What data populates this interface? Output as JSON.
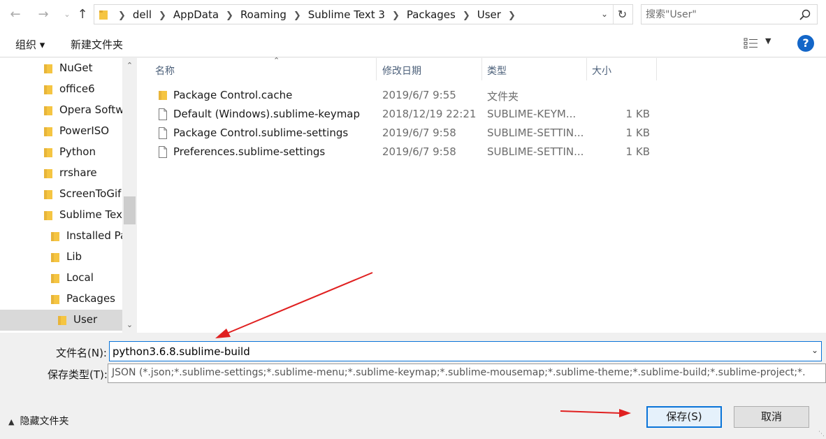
{
  "address": {
    "crumbs": [
      "dell",
      "AppData",
      "Roaming",
      "Sublime Text 3",
      "Packages",
      "User"
    ]
  },
  "search": {
    "placeholder": "搜索\"User\""
  },
  "toolbar": {
    "organize": "组织 ▾",
    "new_folder": "新建文件夹",
    "help": "?"
  },
  "tree": {
    "items": [
      {
        "label": "NuGet",
        "indent": 0,
        "selected": false
      },
      {
        "label": "office6",
        "indent": 0,
        "selected": false
      },
      {
        "label": "Opera Softw",
        "indent": 0,
        "selected": false
      },
      {
        "label": "PowerISO",
        "indent": 0,
        "selected": false
      },
      {
        "label": "Python",
        "indent": 0,
        "selected": false
      },
      {
        "label": "rrshare",
        "indent": 0,
        "selected": false
      },
      {
        "label": "ScreenToGif",
        "indent": 0,
        "selected": false
      },
      {
        "label": "Sublime Tex",
        "indent": 0,
        "selected": false
      },
      {
        "label": "Installed Pa",
        "indent": 1,
        "selected": false
      },
      {
        "label": "Lib",
        "indent": 1,
        "selected": false
      },
      {
        "label": "Local",
        "indent": 1,
        "selected": false
      },
      {
        "label": "Packages",
        "indent": 1,
        "selected": false
      },
      {
        "label": "User",
        "indent": 2,
        "selected": true
      }
    ]
  },
  "columns": {
    "name": "名称",
    "date": "修改日期",
    "type": "类型",
    "size": "大小"
  },
  "files": [
    {
      "name": "Package Control.cache",
      "date": "2019/6/7 9:55",
      "type": "文件夹",
      "size": "",
      "kind": "folder"
    },
    {
      "name": "Default (Windows).sublime-keymap",
      "date": "2018/12/19 22:21",
      "type": "SUBLIME-KEYM...",
      "size": "1 KB",
      "kind": "file"
    },
    {
      "name": "Package Control.sublime-settings",
      "date": "2019/6/7 9:58",
      "type": "SUBLIME-SETTIN...",
      "size": "1 KB",
      "kind": "file"
    },
    {
      "name": "Preferences.sublime-settings",
      "date": "2019/6/7 9:58",
      "type": "SUBLIME-SETTIN...",
      "size": "1 KB",
      "kind": "file"
    }
  ],
  "bottom": {
    "filename_label": "文件名(N):",
    "filename_value": "python3.6.8.sublime-build",
    "filetype_label": "保存类型(T):",
    "filetype_value": "JSON (*.json;*.sublime-settings;*.sublime-menu;*.sublime-keymap;*.sublime-mousemap;*.sublime-theme;*.sublime-build;*.sublime-project;*.",
    "hide_folders": "隐藏文件夹",
    "save_label": "保存(S)",
    "cancel_label": "取消"
  },
  "colors": {
    "accent": "#0a74d8",
    "arrow": "#e02020",
    "folder": "#f5c542"
  }
}
